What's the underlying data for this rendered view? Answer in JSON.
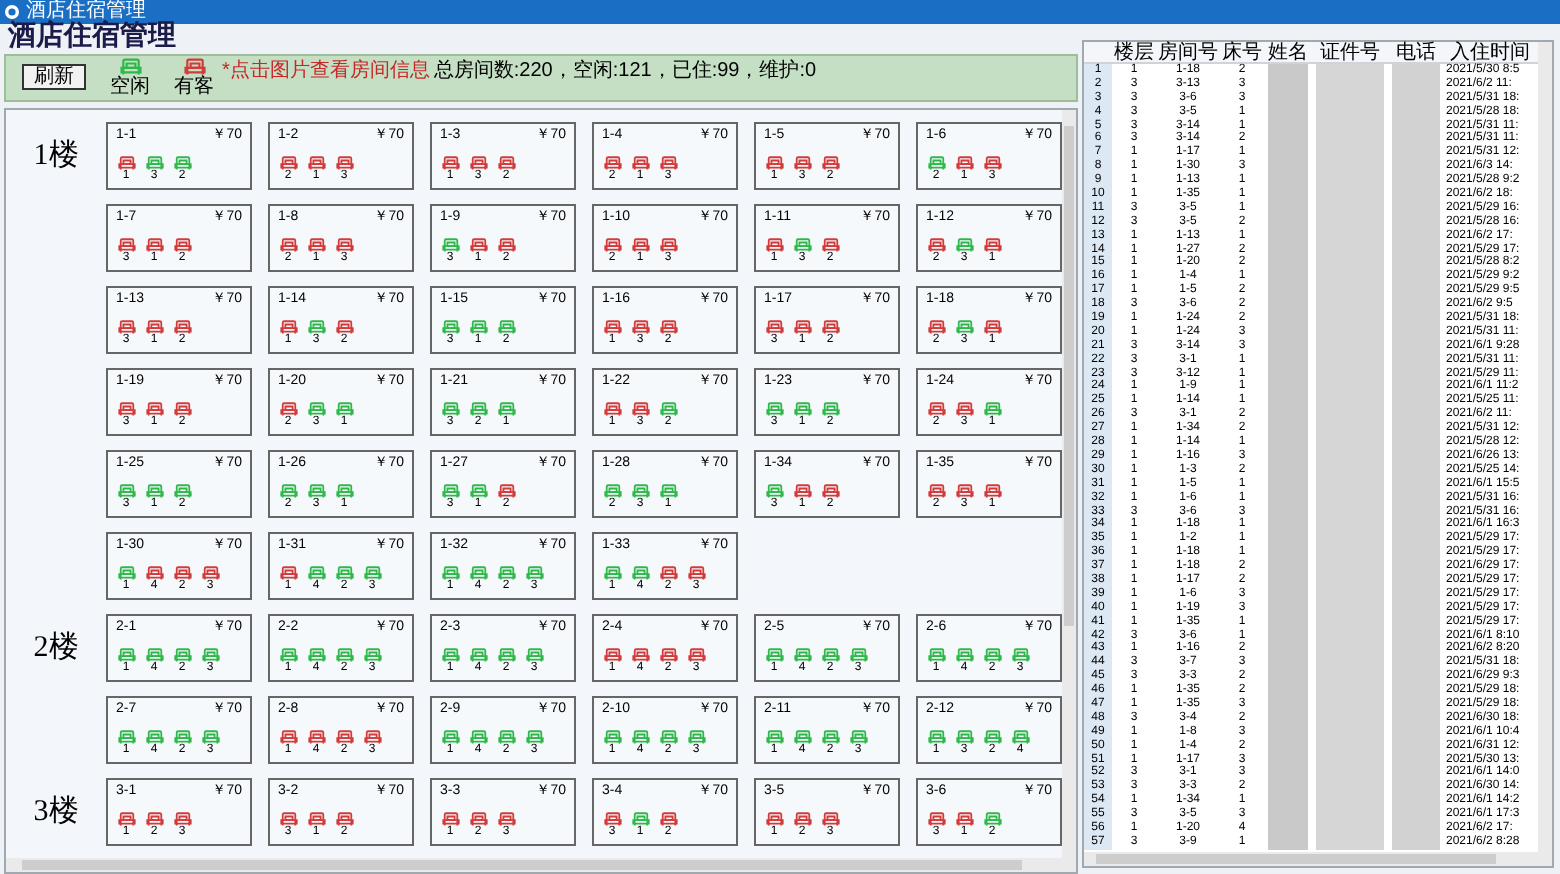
{
  "window": {
    "title": "酒店住宿管理"
  },
  "header": {
    "title": "酒店住宿管理"
  },
  "toolbar": {
    "refresh_button": "刷新",
    "legend": [
      {
        "label": "空闲",
        "occupied": false
      },
      {
        "label": "有客",
        "occupied": true
      }
    ],
    "hint": "*点击图片查看房间信息",
    "summary": "总房间数:220，空闲:121，已住:99，维护:0"
  },
  "floors": [
    {
      "label": "1楼",
      "rooms": [
        {
          "name": "1-1",
          "price": "￥70",
          "beds": [
            {
              "number": "1",
              "occupied": true
            },
            {
              "number": "3",
              "occupied": false
            },
            {
              "number": "2",
              "occupied": false
            }
          ]
        },
        {
          "name": "1-2",
          "price": "￥70",
          "beds": [
            {
              "number": "2",
              "occupied": true
            },
            {
              "number": "1",
              "occupied": true
            },
            {
              "number": "3",
              "occupied": true
            }
          ]
        },
        {
          "name": "1-3",
          "price": "￥70",
          "beds": [
            {
              "number": "1",
              "occupied": true
            },
            {
              "number": "3",
              "occupied": true
            },
            {
              "number": "2",
              "occupied": true
            }
          ]
        },
        {
          "name": "1-4",
          "price": "￥70",
          "beds": [
            {
              "number": "2",
              "occupied": true
            },
            {
              "number": "1",
              "occupied": true
            },
            {
              "number": "3",
              "occupied": true
            }
          ]
        },
        {
          "name": "1-5",
          "price": "￥70",
          "beds": [
            {
              "number": "1",
              "occupied": true
            },
            {
              "number": "3",
              "occupied": true
            },
            {
              "number": "2",
              "occupied": true
            }
          ]
        },
        {
          "name": "1-6",
          "price": "￥70",
          "beds": [
            {
              "number": "2",
              "occupied": false
            },
            {
              "number": "1",
              "occupied": true
            },
            {
              "number": "3",
              "occupied": true
            }
          ]
        },
        {
          "name": "1-7",
          "price": "￥70",
          "beds": [
            {
              "number": "3",
              "occupied": true
            },
            {
              "number": "1",
              "occupied": true
            },
            {
              "number": "2",
              "occupied": true
            }
          ]
        },
        {
          "name": "1-8",
          "price": "￥70",
          "beds": [
            {
              "number": "2",
              "occupied": true
            },
            {
              "number": "1",
              "occupied": true
            },
            {
              "number": "3",
              "occupied": true
            }
          ]
        },
        {
          "name": "1-9",
          "price": "￥70",
          "beds": [
            {
              "number": "3",
              "occupied": false
            },
            {
              "number": "1",
              "occupied": true
            },
            {
              "number": "2",
              "occupied": true
            }
          ]
        },
        {
          "name": "1-10",
          "price": "￥70",
          "beds": [
            {
              "number": "2",
              "occupied": true
            },
            {
              "number": "1",
              "occupied": true
            },
            {
              "number": "3",
              "occupied": true
            }
          ]
        },
        {
          "name": "1-11",
          "price": "￥70",
          "beds": [
            {
              "number": "1",
              "occupied": true
            },
            {
              "number": "3",
              "occupied": false
            },
            {
              "number": "2",
              "occupied": true
            }
          ]
        },
        {
          "name": "1-12",
          "price": "￥70",
          "beds": [
            {
              "number": "2",
              "occupied": true
            },
            {
              "number": "3",
              "occupied": false
            },
            {
              "number": "1",
              "occupied": true
            }
          ]
        },
        {
          "name": "1-13",
          "price": "￥70",
          "beds": [
            {
              "number": "3",
              "occupied": true
            },
            {
              "number": "1",
              "occupied": true
            },
            {
              "number": "2",
              "occupied": true
            }
          ]
        },
        {
          "name": "1-14",
          "price": "￥70",
          "beds": [
            {
              "number": "1",
              "occupied": true
            },
            {
              "number": "3",
              "occupied": false
            },
            {
              "number": "2",
              "occupied": true
            }
          ]
        },
        {
          "name": "1-15",
          "price": "￥70",
          "beds": [
            {
              "number": "3",
              "occupied": false
            },
            {
              "number": "1",
              "occupied": false
            },
            {
              "number": "2",
              "occupied": false
            }
          ]
        },
        {
          "name": "1-16",
          "price": "￥70",
          "beds": [
            {
              "number": "1",
              "occupied": true
            },
            {
              "number": "3",
              "occupied": true
            },
            {
              "number": "2",
              "occupied": true
            }
          ]
        },
        {
          "name": "1-17",
          "price": "￥70",
          "beds": [
            {
              "number": "3",
              "occupied": true
            },
            {
              "number": "1",
              "occupied": true
            },
            {
              "number": "2",
              "occupied": true
            }
          ]
        },
        {
          "name": "1-18",
          "price": "￥70",
          "beds": [
            {
              "number": "2",
              "occupied": true
            },
            {
              "number": "3",
              "occupied": false
            },
            {
              "number": "1",
              "occupied": true
            }
          ]
        },
        {
          "name": "1-19",
          "price": "￥70",
          "beds": [
            {
              "number": "3",
              "occupied": true
            },
            {
              "number": "1",
              "occupied": true
            },
            {
              "number": "2",
              "occupied": true
            }
          ]
        },
        {
          "name": "1-20",
          "price": "￥70",
          "beds": [
            {
              "number": "2",
              "occupied": true
            },
            {
              "number": "3",
              "occupied": false
            },
            {
              "number": "1",
              "occupied": false
            }
          ]
        },
        {
          "name": "1-21",
          "price": "￥70",
          "beds": [
            {
              "number": "3",
              "occupied": false
            },
            {
              "number": "2",
              "occupied": false
            },
            {
              "number": "1",
              "occupied": false
            }
          ]
        },
        {
          "name": "1-22",
          "price": "￥70",
          "beds": [
            {
              "number": "1",
              "occupied": true
            },
            {
              "number": "3",
              "occupied": true
            },
            {
              "number": "2",
              "occupied": false
            }
          ]
        },
        {
          "name": "1-23",
          "price": "￥70",
          "beds": [
            {
              "number": "3",
              "occupied": false
            },
            {
              "number": "1",
              "occupied": false
            },
            {
              "number": "2",
              "occupied": false
            }
          ]
        },
        {
          "name": "1-24",
          "price": "￥70",
          "beds": [
            {
              "number": "2",
              "occupied": true
            },
            {
              "number": "3",
              "occupied": true
            },
            {
              "number": "1",
              "occupied": false
            }
          ]
        },
        {
          "name": "1-25",
          "price": "￥70",
          "beds": [
            {
              "number": "3",
              "occupied": false
            },
            {
              "number": "1",
              "occupied": false
            },
            {
              "number": "2",
              "occupied": false
            }
          ]
        },
        {
          "name": "1-26",
          "price": "￥70",
          "beds": [
            {
              "number": "2",
              "occupied": false
            },
            {
              "number": "3",
              "occupied": false
            },
            {
              "number": "1",
              "occupied": false
            }
          ]
        },
        {
          "name": "1-27",
          "price": "￥70",
          "beds": [
            {
              "number": "3",
              "occupied": false
            },
            {
              "number": "1",
              "occupied": false
            },
            {
              "number": "2",
              "occupied": true
            }
          ]
        },
        {
          "name": "1-28",
          "price": "￥70",
          "beds": [
            {
              "number": "2",
              "occupied": false
            },
            {
              "number": "3",
              "occupied": false
            },
            {
              "number": "1",
              "occupied": false
            }
          ]
        },
        {
          "name": "1-34",
          "price": "￥70",
          "beds": [
            {
              "number": "3",
              "occupied": false
            },
            {
              "number": "1",
              "occupied": true
            },
            {
              "number": "2",
              "occupied": true
            }
          ]
        },
        {
          "name": "1-35",
          "price": "￥70",
          "beds": [
            {
              "number": "2",
              "occupied": true
            },
            {
              "number": "3",
              "occupied": true
            },
            {
              "number": "1",
              "occupied": true
            }
          ]
        },
        {
          "name": "1-30",
          "price": "￥70",
          "beds": [
            {
              "number": "1",
              "occupied": false
            },
            {
              "number": "4",
              "occupied": true
            },
            {
              "number": "2",
              "occupied": true
            },
            {
              "number": "3",
              "occupied": true
            }
          ]
        },
        {
          "name": "1-31",
          "price": "￥70",
          "beds": [
            {
              "number": "1",
              "occupied": true
            },
            {
              "number": "4",
              "occupied": false
            },
            {
              "number": "2",
              "occupied": false
            },
            {
              "number": "3",
              "occupied": false
            }
          ]
        },
        {
          "name": "1-32",
          "price": "￥70",
          "beds": [
            {
              "number": "1",
              "occupied": false
            },
            {
              "number": "4",
              "occupied": false
            },
            {
              "number": "2",
              "occupied": false
            },
            {
              "number": "3",
              "occupied": false
            }
          ]
        },
        {
          "name": "1-33",
          "price": "￥70",
          "beds": [
            {
              "number": "1",
              "occupied": false
            },
            {
              "number": "4",
              "occupied": false
            },
            {
              "number": "2",
              "occupied": true
            },
            {
              "number": "3",
              "occupied": true
            }
          ]
        }
      ]
    },
    {
      "label": "2楼",
      "rooms": [
        {
          "name": "2-1",
          "price": "￥70",
          "beds": [
            {
              "number": "1",
              "occupied": false
            },
            {
              "number": "4",
              "occupied": false
            },
            {
              "number": "2",
              "occupied": false
            },
            {
              "number": "3",
              "occupied": false
            }
          ]
        },
        {
          "name": "2-2",
          "price": "￥70",
          "beds": [
            {
              "number": "1",
              "occupied": false
            },
            {
              "number": "4",
              "occupied": false
            },
            {
              "number": "2",
              "occupied": false
            },
            {
              "number": "3",
              "occupied": false
            }
          ]
        },
        {
          "name": "2-3",
          "price": "￥70",
          "beds": [
            {
              "number": "1",
              "occupied": false
            },
            {
              "number": "4",
              "occupied": false
            },
            {
              "number": "2",
              "occupied": false
            },
            {
              "number": "3",
              "occupied": false
            }
          ]
        },
        {
          "name": "2-4",
          "price": "￥70",
          "beds": [
            {
              "number": "1",
              "occupied": true
            },
            {
              "number": "4",
              "occupied": true
            },
            {
              "number": "2",
              "occupied": true
            },
            {
              "number": "3",
              "occupied": true
            }
          ]
        },
        {
          "name": "2-5",
          "price": "￥70",
          "beds": [
            {
              "number": "1",
              "occupied": false
            },
            {
              "number": "4",
              "occupied": false
            },
            {
              "number": "2",
              "occupied": false
            },
            {
              "number": "3",
              "occupied": false
            }
          ]
        },
        {
          "name": "2-6",
          "price": "￥70",
          "beds": [
            {
              "number": "1",
              "occupied": false
            },
            {
              "number": "4",
              "occupied": false
            },
            {
              "number": "2",
              "occupied": false
            },
            {
              "number": "3",
              "occupied": false
            }
          ]
        },
        {
          "name": "2-7",
          "price": "￥70",
          "beds": [
            {
              "number": "1",
              "occupied": false
            },
            {
              "number": "4",
              "occupied": false
            },
            {
              "number": "2",
              "occupied": false
            },
            {
              "number": "3",
              "occupied": false
            }
          ]
        },
        {
          "name": "2-8",
          "price": "￥70",
          "beds": [
            {
              "number": "1",
              "occupied": true
            },
            {
              "number": "4",
              "occupied": true
            },
            {
              "number": "2",
              "occupied": true
            },
            {
              "number": "3",
              "occupied": true
            }
          ]
        },
        {
          "name": "2-9",
          "price": "￥70",
          "beds": [
            {
              "number": "1",
              "occupied": false
            },
            {
              "number": "4",
              "occupied": false
            },
            {
              "number": "2",
              "occupied": false
            },
            {
              "number": "3",
              "occupied": false
            }
          ]
        },
        {
          "name": "2-10",
          "price": "￥70",
          "beds": [
            {
              "number": "1",
              "occupied": false
            },
            {
              "number": "4",
              "occupied": false
            },
            {
              "number": "2",
              "occupied": false
            },
            {
              "number": "3",
              "occupied": false
            }
          ]
        },
        {
          "name": "2-11",
          "price": "￥70",
          "beds": [
            {
              "number": "1",
              "occupied": false
            },
            {
              "number": "4",
              "occupied": false
            },
            {
              "number": "2",
              "occupied": false
            },
            {
              "number": "3",
              "occupied": false
            }
          ]
        },
        {
          "name": "2-12",
          "price": "￥70",
          "beds": [
            {
              "number": "1",
              "occupied": false
            },
            {
              "number": "3",
              "occupied": false
            },
            {
              "number": "2",
              "occupied": false
            },
            {
              "number": "4",
              "occupied": false
            }
          ]
        }
      ]
    },
    {
      "label": "3楼",
      "rooms": [
        {
          "name": "3-1",
          "price": "￥70",
          "beds": [
            {
              "number": "1",
              "occupied": true
            },
            {
              "number": "2",
              "occupied": true
            },
            {
              "number": "3",
              "occupied": true
            }
          ]
        },
        {
          "name": "3-2",
          "price": "￥70",
          "beds": [
            {
              "number": "3",
              "occupied": true
            },
            {
              "number": "1",
              "occupied": true
            },
            {
              "number": "2",
              "occupied": true
            }
          ]
        },
        {
          "name": "3-3",
          "price": "￥70",
          "beds": [
            {
              "number": "1",
              "occupied": true
            },
            {
              "number": "2",
              "occupied": true
            },
            {
              "number": "3",
              "occupied": true
            }
          ]
        },
        {
          "name": "3-4",
          "price": "￥70",
          "beds": [
            {
              "number": "3",
              "occupied": true
            },
            {
              "number": "1",
              "occupied": false
            },
            {
              "number": "2",
              "occupied": true
            }
          ]
        },
        {
          "name": "3-5",
          "price": "￥70",
          "beds": [
            {
              "number": "1",
              "occupied": true
            },
            {
              "number": "2",
              "occupied": true
            },
            {
              "number": "3",
              "occupied": true
            }
          ]
        },
        {
          "name": "3-6",
          "price": "￥70",
          "beds": [
            {
              "number": "3",
              "occupied": true
            },
            {
              "number": "1",
              "occupied": true
            },
            {
              "number": "2",
              "occupied": false
            }
          ]
        }
      ]
    }
  ],
  "table": {
    "columns": [
      "楼层",
      "房间号",
      "床号",
      "姓名",
      "证件号",
      "电话",
      "入住时间"
    ],
    "rows": [
      {
        "index": "1",
        "floor": "1",
        "room": "1-18",
        "bed": "2",
        "time": "2021/5/30 8:5"
      },
      {
        "index": "2",
        "floor": "3",
        "room": "3-13",
        "bed": "3",
        "time": "2021/6/2 11:"
      },
      {
        "index": "3",
        "floor": "3",
        "room": "3-6",
        "bed": "3",
        "time": "2021/5/31 18:"
      },
      {
        "index": "4",
        "floor": "3",
        "room": "3-5",
        "bed": "1",
        "time": "2021/5/28 18:"
      },
      {
        "index": "5",
        "floor": "3",
        "room": "3-14",
        "bed": "1",
        "time": "2021/5/31 11:"
      },
      {
        "index": "6",
        "floor": "3",
        "room": "3-14",
        "bed": "2",
        "time": "2021/5/31 11:"
      },
      {
        "index": "7",
        "floor": "1",
        "room": "1-17",
        "bed": "1",
        "time": "2021/5/31 12:"
      },
      {
        "index": "8",
        "floor": "1",
        "room": "1-30",
        "bed": "3",
        "time": "2021/6/3 14:"
      },
      {
        "index": "9",
        "floor": "1",
        "room": "1-13",
        "bed": "1",
        "time": "2021/5/28 9:2"
      },
      {
        "index": "10",
        "floor": "1",
        "room": "1-35",
        "bed": "1",
        "time": "2021/6/2 18:"
      },
      {
        "index": "11",
        "floor": "3",
        "room": "3-5",
        "bed": "1",
        "time": "2021/5/29 16:"
      },
      {
        "index": "12",
        "floor": "3",
        "room": "3-5",
        "bed": "2",
        "time": "2021/5/28 16:"
      },
      {
        "index": "13",
        "floor": "1",
        "room": "1-13",
        "bed": "1",
        "time": "2021/6/2 17:"
      },
      {
        "index": "14",
        "floor": "1",
        "room": "1-27",
        "bed": "2",
        "time": "2021/5/29 17:"
      },
      {
        "index": "15",
        "floor": "1",
        "room": "1-20",
        "bed": "2",
        "time": "2021/5/28 8:2"
      },
      {
        "index": "16",
        "floor": "1",
        "room": "1-4",
        "bed": "1",
        "time": "2021/5/29 9:2"
      },
      {
        "index": "17",
        "floor": "1",
        "room": "1-5",
        "bed": "2",
        "time": "2021/5/29 9:5"
      },
      {
        "index": "18",
        "floor": "3",
        "room": "3-6",
        "bed": "2",
        "time": "2021/6/2 9:5"
      },
      {
        "index": "19",
        "floor": "1",
        "room": "1-24",
        "bed": "2",
        "time": "2021/5/31 18:"
      },
      {
        "index": "20",
        "floor": "1",
        "room": "1-24",
        "bed": "3",
        "time": "2021/5/31 11:"
      },
      {
        "index": "21",
        "floor": "3",
        "room": "3-14",
        "bed": "3",
        "time": "2021/6/1 9:28"
      },
      {
        "index": "22",
        "floor": "3",
        "room": "3-1",
        "bed": "1",
        "time": "2021/5/31 11:"
      },
      {
        "index": "23",
        "floor": "3",
        "room": "3-12",
        "bed": "1",
        "time": "2021/5/29 11:"
      },
      {
        "index": "24",
        "floor": "1",
        "room": "1-9",
        "bed": "1",
        "time": "2021/6/1 11:2"
      },
      {
        "index": "25",
        "floor": "1",
        "room": "1-14",
        "bed": "1",
        "time": "2021/5/25 11:"
      },
      {
        "index": "26",
        "floor": "3",
        "room": "3-1",
        "bed": "2",
        "time": "2021/6/2 11:"
      },
      {
        "index": "27",
        "floor": "1",
        "room": "1-34",
        "bed": "2",
        "time": "2021/5/31 12:"
      },
      {
        "index": "28",
        "floor": "1",
        "room": "1-14",
        "bed": "1",
        "time": "2021/5/28 12:"
      },
      {
        "index": "29",
        "floor": "1",
        "room": "1-16",
        "bed": "3",
        "time": "2021/6/26 13:"
      },
      {
        "index": "30",
        "floor": "1",
        "room": "1-3",
        "bed": "2",
        "time": "2021/5/25 14:"
      },
      {
        "index": "31",
        "floor": "1",
        "room": "1-5",
        "bed": "1",
        "time": "2021/6/1 15:5"
      },
      {
        "index": "32",
        "floor": "1",
        "room": "1-6",
        "bed": "1",
        "time": "2021/5/31 16:"
      },
      {
        "index": "33",
        "floor": "3",
        "room": "3-6",
        "bed": "3",
        "time": "2021/5/31 16:"
      },
      {
        "index": "34",
        "floor": "1",
        "room": "1-18",
        "bed": "1",
        "time": "2021/6/1 16:3"
      },
      {
        "index": "35",
        "floor": "1",
        "room": "1-2",
        "bed": "1",
        "time": "2021/5/29 17:"
      },
      {
        "index": "36",
        "floor": "1",
        "room": "1-18",
        "bed": "1",
        "time": "2021/5/29 17:"
      },
      {
        "index": "37",
        "floor": "1",
        "room": "1-18",
        "bed": "2",
        "time": "2021/6/29 17:"
      },
      {
        "index": "38",
        "floor": "1",
        "room": "1-17",
        "bed": "2",
        "time": "2021/5/29 17:"
      },
      {
        "index": "39",
        "floor": "1",
        "room": "1-6",
        "bed": "3",
        "time": "2021/5/29 17:"
      },
      {
        "index": "40",
        "floor": "1",
        "room": "1-19",
        "bed": "3",
        "time": "2021/5/29 17:"
      },
      {
        "index": "41",
        "floor": "1",
        "room": "1-35",
        "bed": "1",
        "time": "2021/5/29 17:"
      },
      {
        "index": "42",
        "floor": "3",
        "room": "3-6",
        "bed": "1",
        "time": "2021/6/1 8:10"
      },
      {
        "index": "43",
        "floor": "1",
        "room": "1-16",
        "bed": "2",
        "time": "2021/6/2 8:20"
      },
      {
        "index": "44",
        "floor": "3",
        "room": "3-7",
        "bed": "3",
        "time": "2021/5/31 18:"
      },
      {
        "index": "45",
        "floor": "3",
        "room": "3-3",
        "bed": "2",
        "time": "2021/6/29 9:3"
      },
      {
        "index": "46",
        "floor": "1",
        "room": "1-35",
        "bed": "2",
        "time": "2021/5/29 18:"
      },
      {
        "index": "47",
        "floor": "1",
        "room": "1-35",
        "bed": "3",
        "time": "2021/5/29 18:"
      },
      {
        "index": "48",
        "floor": "3",
        "room": "3-4",
        "bed": "2",
        "time": "2021/6/30 18:"
      },
      {
        "index": "49",
        "floor": "1",
        "room": "1-8",
        "bed": "3",
        "time": "2021/6/1 10:4"
      },
      {
        "index": "50",
        "floor": "1",
        "room": "1-4",
        "bed": "2",
        "time": "2021/6/31 12:"
      },
      {
        "index": "51",
        "floor": "1",
        "room": "1-17",
        "bed": "3",
        "time": "2021/5/30 13:"
      },
      {
        "index": "52",
        "floor": "3",
        "room": "3-1",
        "bed": "3",
        "time": "2021/6/1 14:0"
      },
      {
        "index": "53",
        "floor": "3",
        "room": "3-3",
        "bed": "2",
        "time": "2021/6/30 14:"
      },
      {
        "index": "54",
        "floor": "1",
        "room": "1-34",
        "bed": "1",
        "time": "2021/6/1 14:2"
      },
      {
        "index": "55",
        "floor": "3",
        "room": "3-5",
        "bed": "3",
        "time": "2021/6/1 17:3"
      },
      {
        "index": "56",
        "floor": "1",
        "room": "1-20",
        "bed": "4",
        "time": "2021/6/2 17:"
      },
      {
        "index": "57",
        "floor": "3",
        "room": "3-9",
        "bed": "1",
        "time": "2021/6/2 8:28"
      }
    ]
  }
}
